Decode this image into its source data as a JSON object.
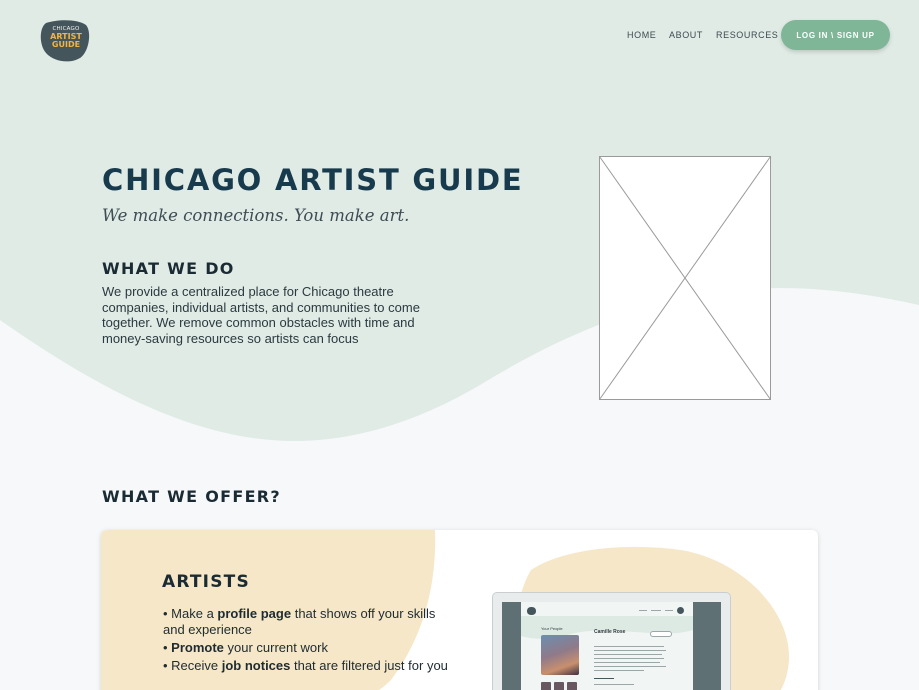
{
  "header": {
    "logo": {
      "line1": "CHICAGO",
      "line2": "ARTIST",
      "line3": "GUIDE"
    },
    "nav": [
      {
        "label": "HOME"
      },
      {
        "label": "ABOUT"
      },
      {
        "label": "RESOURCES"
      }
    ],
    "login_label": "LOG IN \\ SIGN UP"
  },
  "hero": {
    "title": "CHICAGO ARTIST GUIDE",
    "tagline": "We make connections. You make art.",
    "what_we_do_heading": "WHAT WE DO",
    "what_we_do_body": "We provide a centralized place for Chicago theatre companies, individual artists, and communities to come together. We remove common obstacles with time and money-saving resources so artists can focus"
  },
  "offer": {
    "heading": "WHAT WE OFFER?",
    "artists_card": {
      "heading": "ARTISTS",
      "items": [
        {
          "pre": "• Make a ",
          "bold": "profile page",
          "post": " that shows off your skills and experience"
        },
        {
          "pre": "• ",
          "bold": "Promote",
          "post": " your current work"
        },
        {
          "pre": "• Receive ",
          "bold": "job notices",
          "post": " that are filtered just for you"
        }
      ],
      "mock_profile": {
        "section_label": "Your People",
        "name": "Camille Rose"
      }
    }
  },
  "colors": {
    "hero_bg": "#e0ebe5",
    "page_bg": "#f6f8f9",
    "accent_green": "#7fb697",
    "heading_navy": "#173a4d",
    "logo_bg": "#44565c",
    "logo_gold": "#f2b544",
    "card_blob": "#f6e7c8"
  },
  "icons": {
    "hero_image": "image-placeholder-icon",
    "logo": "logo-badge-icon"
  }
}
